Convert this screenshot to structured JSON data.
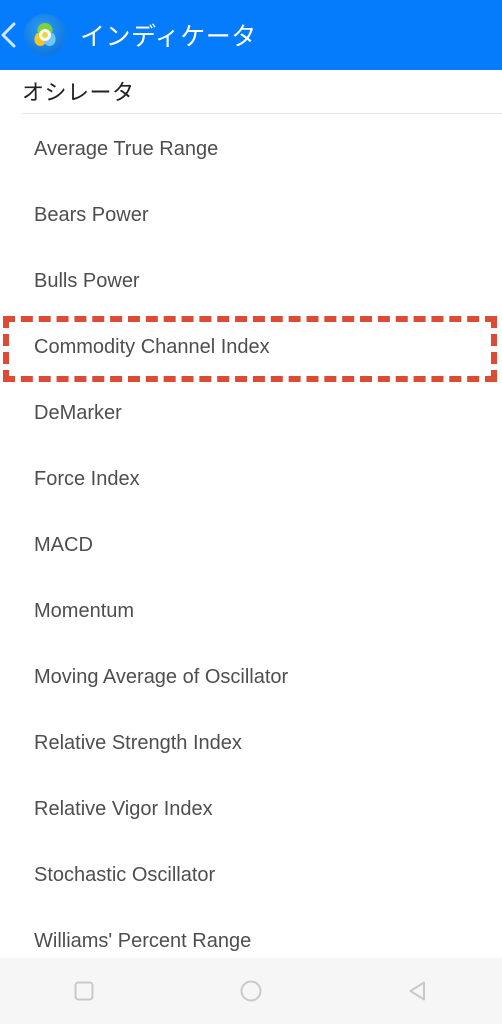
{
  "appbar": {
    "back_icon": "chevron-left-icon",
    "app_icon": "metatrader-app-icon",
    "title": "インディケータ",
    "background_color": "#057cfb",
    "title_color": "#ffffff"
  },
  "section": {
    "label": "オシレータ",
    "divider_color": "#e6e6e6"
  },
  "list": {
    "items": [
      {
        "label": "Average True Range"
      },
      {
        "label": "Bears Power"
      },
      {
        "label": "Bulls Power"
      },
      {
        "label": "Commodity Channel Index"
      },
      {
        "label": "DeMarker"
      },
      {
        "label": "Force Index"
      },
      {
        "label": "MACD"
      },
      {
        "label": "Momentum"
      },
      {
        "label": "Moving Average of Oscillator"
      },
      {
        "label": "Relative Strength Index"
      },
      {
        "label": "Relative Vigor Index"
      },
      {
        "label": "Stochastic Oscillator"
      },
      {
        "label": "Williams' Percent Range"
      }
    ],
    "text_color": "#4e4e4e"
  },
  "highlight": {
    "target_label": "Commodity Channel Index",
    "color": "#dc4b33",
    "style": "dashed"
  },
  "navbar": {
    "background_color": "#f6f6f6",
    "icon_color": "#c9c9c9",
    "buttons": [
      {
        "name": "recents-square-icon"
      },
      {
        "name": "home-circle-icon"
      },
      {
        "name": "back-triangle-icon"
      }
    ]
  }
}
